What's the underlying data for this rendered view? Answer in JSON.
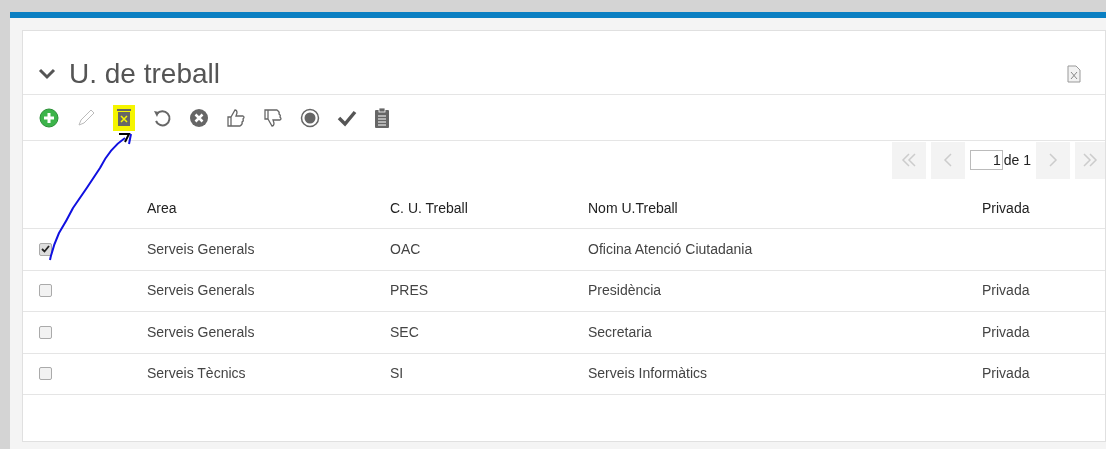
{
  "panel": {
    "title": "U. de treball"
  },
  "pager": {
    "page": "1",
    "of": "de 1"
  },
  "table": {
    "columns": [
      "Area",
      "C. U. Treball",
      "Nom U.Treball",
      "Privada"
    ],
    "rows": [
      {
        "checked": true,
        "area": "Serveis Generals",
        "code": "OAC",
        "name": "Oficina Atenció Ciutadania"
      },
      {
        "checked": false,
        "area": "Serveis Generals",
        "code": "PRES",
        "name": "Presidència",
        "privada": "Privada"
      },
      {
        "checked": false,
        "area": "Serveis Generals",
        "code": "SEC",
        "name": "Secretaria",
        "privada": "Privada"
      },
      {
        "checked": false,
        "area": "Serveis Tècnics",
        "code": "SI",
        "name": "Serveis Informàtics",
        "privada": "Privada"
      }
    ]
  }
}
